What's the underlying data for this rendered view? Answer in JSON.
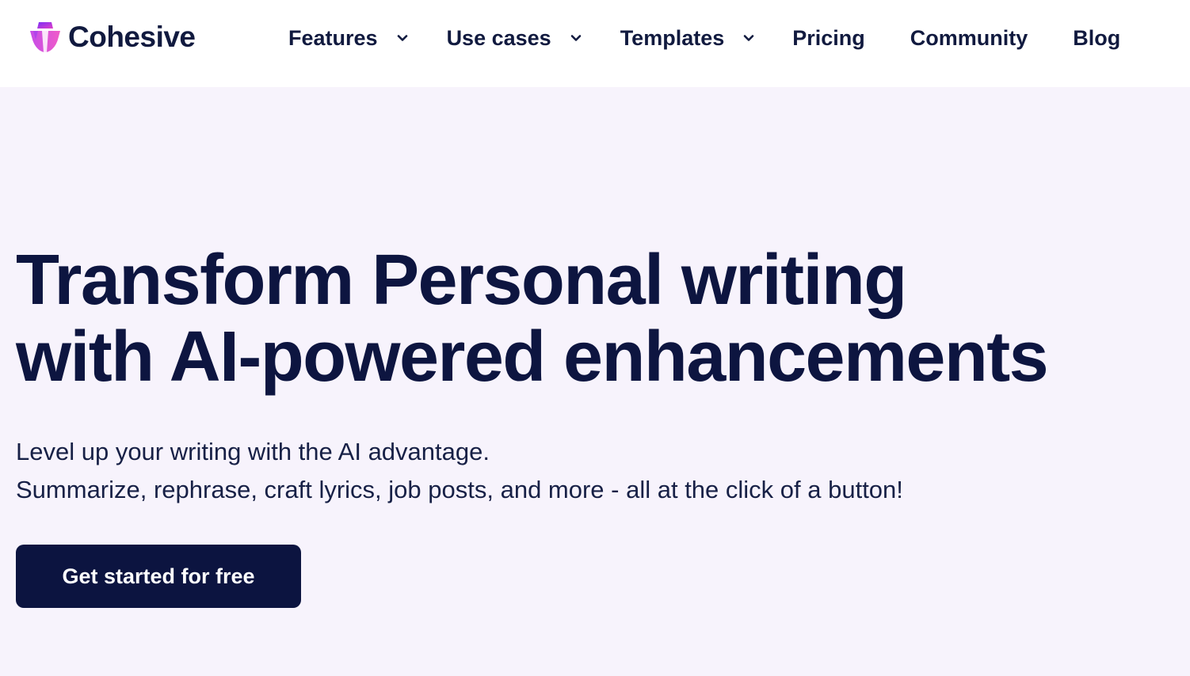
{
  "brand": {
    "name": "Cohesive",
    "logo_icon": "cohesive-logo-icon",
    "logo_colors": [
      "#7b2ff7",
      "#e040c8"
    ]
  },
  "nav": {
    "features": "Features",
    "use_cases": "Use cases",
    "templates": "Templates",
    "pricing": "Pricing",
    "community": "Community",
    "blog": "Blog",
    "dropdown_icon": "chevron-down-icon"
  },
  "hero": {
    "title_line1": "Transform Personal writing",
    "title_line2": "with AI-powered enhancements",
    "subtitle_line1": "Level up your writing with the AI advantage.",
    "subtitle_line2": "Summarize, rephrase, craft lyrics, job posts, and more - all at the click of a button!",
    "cta_label": "Get started for free"
  },
  "colors": {
    "page_background": "#f7f3fc",
    "header_background": "#ffffff",
    "text_primary": "#0d1540",
    "cta_background": "#0c1440",
    "cta_text": "#ffffff"
  }
}
